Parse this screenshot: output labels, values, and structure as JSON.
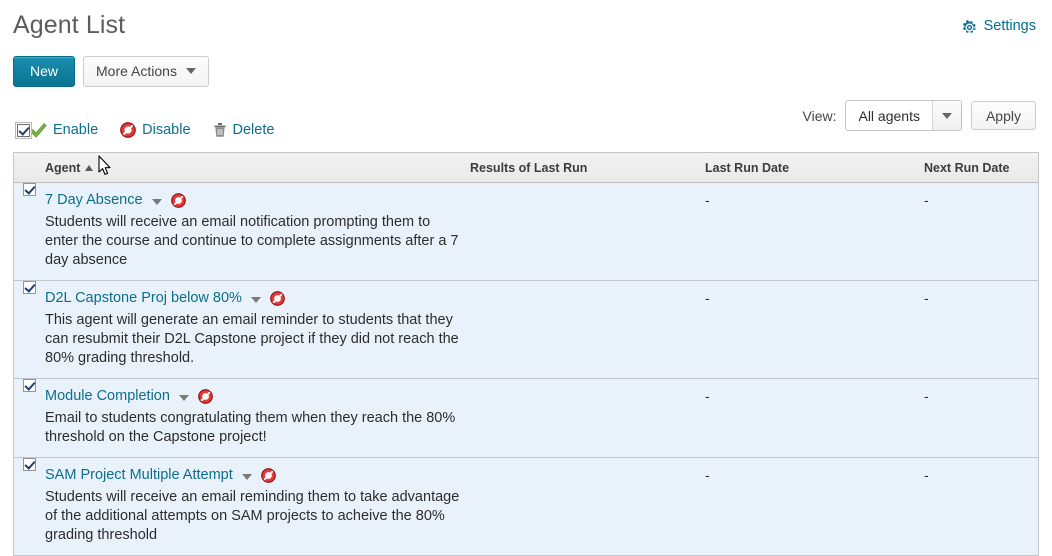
{
  "header": {
    "title": "Agent List",
    "settings_label": "Settings",
    "settings_icon": "gear-icon"
  },
  "toolbar": {
    "new_label": "New",
    "more_actions_label": "More Actions",
    "more_actions_icon": "chevron-down-icon"
  },
  "view_bar": {
    "view_label": "View:",
    "selected_value": "All agents",
    "dropdown_icon": "chevron-down-icon",
    "apply_label": "Apply"
  },
  "actions": {
    "select_all_checked": true,
    "enable_label": "Enable",
    "enable_icon": "green-check-icon",
    "disable_label": "Disable",
    "disable_icon": "red-ban-icon",
    "delete_label": "Delete",
    "delete_icon": "trash-icon"
  },
  "table": {
    "columns": {
      "agent": "Agent",
      "sort_direction": "ascending",
      "results_of_last_run": "Results of Last Run",
      "last_run_date": "Last Run Date",
      "next_run_date": "Next Run Date"
    },
    "rows": [
      {
        "checked": true,
        "name": "7 Day Absence",
        "dropdown_icon": "chevron-down-icon",
        "status_icon": "red-ban-icon",
        "description": "Students will receive an email notification prompting them to enter the course and continue to complete assignments after a 7 day absence",
        "results_of_last_run": "",
        "last_run_date": "-",
        "next_run_date": "-"
      },
      {
        "checked": true,
        "name": "D2L Capstone Proj below 80%",
        "dropdown_icon": "chevron-down-icon",
        "status_icon": "red-ban-icon",
        "description": "This agent will generate an email reminder to students that they can resubmit their D2L Capstone project if they did not reach the 80% grading threshold.",
        "results_of_last_run": "",
        "last_run_date": "-",
        "next_run_date": "-"
      },
      {
        "checked": true,
        "name": "Module Completion",
        "dropdown_icon": "chevron-down-icon",
        "status_icon": "red-ban-icon",
        "description": "Email to students congratulating them when they reach the 80% threshold on the Capstone project!",
        "results_of_last_run": "",
        "last_run_date": "-",
        "next_run_date": "-"
      },
      {
        "checked": true,
        "name": "SAM Project Multiple Attempt",
        "dropdown_icon": "chevron-down-icon",
        "status_icon": "red-ban-icon",
        "description": "Students will receive an email reminding them to take advantage of the additional attempts on SAM projects to acheive the 80% grading threshold",
        "results_of_last_run": "",
        "last_run_date": "-",
        "next_run_date": "-"
      }
    ]
  },
  "colors": {
    "accent_link": "#0d6e8c",
    "primary_button": "#12809f",
    "row_background": "#e9f2fb",
    "header_background": "#eeeeee",
    "danger": "#d9252a",
    "success": "#7cb342"
  }
}
